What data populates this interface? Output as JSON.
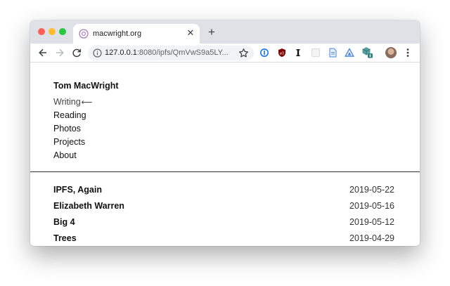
{
  "browser": {
    "tab": {
      "title": "macwright.org",
      "close_glyph": "✕"
    },
    "new_tab_glyph": "+",
    "address": {
      "host": "127.0.0.1",
      "rest": ":8080/ipfs/QmVwS9a5LY..."
    },
    "icons": [
      "back-icon",
      "forward-icon",
      "reload-icon",
      "info-icon",
      "star-icon",
      "onepassword-extension-icon",
      "ublock-extension-icon",
      "instapaper-extension-icon",
      "blank-extension-icon",
      "doc-extension-icon",
      "triangle-extension-icon",
      "cube-extension-icon",
      "profile-avatar",
      "menu-icon"
    ],
    "colors": {
      "tabstrip": "#dee1e6",
      "close": "#ff5f57",
      "minimize": "#febc2e",
      "maximize": "#28c840"
    }
  },
  "site": {
    "name": "Tom MacWright",
    "nav": [
      {
        "label": "Writing",
        "active": true,
        "arrow": "⟵"
      },
      {
        "label": "Reading"
      },
      {
        "label": "Photos"
      },
      {
        "label": "Projects"
      },
      {
        "label": "About"
      }
    ]
  },
  "posts": [
    {
      "title": "IPFS, Again",
      "date": "2019-05-22"
    },
    {
      "title": "Elizabeth Warren",
      "date": "2019-05-16"
    },
    {
      "title": "Big 4",
      "date": "2019-05-12"
    },
    {
      "title": "Trees",
      "date": "2019-04-29"
    }
  ]
}
